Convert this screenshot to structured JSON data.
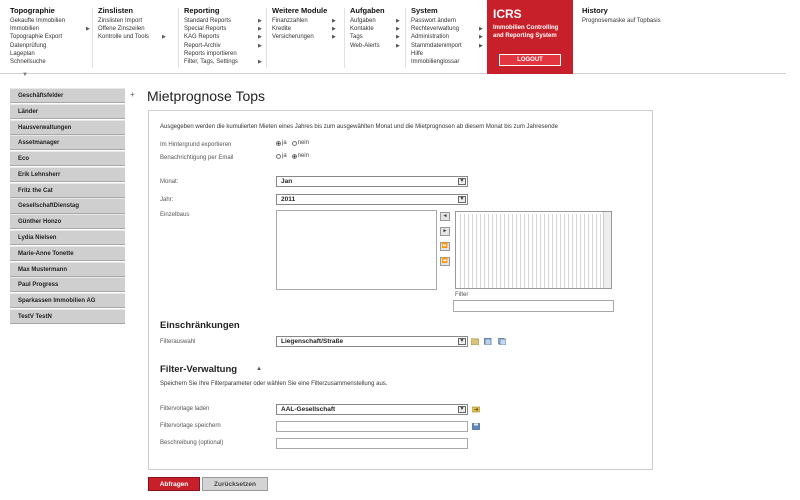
{
  "nav": {
    "columns": [
      {
        "head": "Topographie",
        "items": [
          {
            "label": "Gekaufte Immobilien",
            "sub": false
          },
          {
            "label": "Immobilien",
            "sub": true
          },
          {
            "label": "Topographie Export",
            "sub": false
          },
          {
            "label": "Datenprüfung",
            "sub": false
          },
          {
            "label": "Lageplan",
            "sub": false
          },
          {
            "label": "Schnellsuche",
            "sub": false
          }
        ]
      },
      {
        "head": "Zinslisten",
        "items": [
          {
            "label": "Zinslisten Import",
            "sub": false
          },
          {
            "label": "Offene Zinszeilen",
            "sub": false
          },
          {
            "label": "Kontrolle und Tools",
            "sub": true
          }
        ]
      },
      {
        "head": "Reporting",
        "items": [
          {
            "label": "Standard Reports",
            "sub": true
          },
          {
            "label": "Special Reports",
            "sub": true
          },
          {
            "label": "KAG Reports",
            "sub": true
          },
          {
            "label": "Report-Archiv",
            "sub": true
          },
          {
            "label": "Reports importieren",
            "sub": false
          },
          {
            "label": "Filter, Tags, Settings",
            "sub": true
          }
        ]
      },
      {
        "head": "Weitere Module",
        "items": [
          {
            "label": "Finanzzahlen",
            "sub": true
          },
          {
            "label": "Kredite",
            "sub": true
          },
          {
            "label": "Versicherungen",
            "sub": true
          }
        ]
      },
      {
        "head": "Aufgaben",
        "items": [
          {
            "label": "Aufgaben",
            "sub": true
          },
          {
            "label": "Kontakte",
            "sub": true
          },
          {
            "label": "Tags",
            "sub": true
          },
          {
            "label": "Web-Alerts",
            "sub": true
          }
        ]
      },
      {
        "head": "System",
        "items": [
          {
            "label": "Passwort ändern",
            "sub": false
          },
          {
            "label": "Rechteverwaltung",
            "sub": true
          },
          {
            "label": "Administration",
            "sub": true
          },
          {
            "label": "Stammdatenimport",
            "sub": true
          },
          {
            "label": "Hilfe",
            "sub": false
          },
          {
            "label": "Immobilienglossar",
            "sub": false
          }
        ]
      }
    ],
    "icrs": {
      "title": "ICRS",
      "subtitle": "Immobilien Controlling and Reporting System",
      "logout": "LOGOUT"
    },
    "history": {
      "head": "History",
      "item": "Prognosemaske auf Topbasis"
    },
    "toggle": "▼"
  },
  "sidebar": {
    "plus": "+",
    "items": [
      "Geschäftsfelder",
      "Länder",
      "Hausverwaltungen",
      "Assetmanager",
      "Eco",
      "Erik Lehnsherr",
      "Fritz the Cat",
      "GesellschaftDienstag",
      "Günther Honzo",
      "Lydia Nielsen",
      "Marie-Anne Tonette",
      "Max Mustermann",
      "Paul Progress",
      "Sparkassen Immobilien AG",
      "TestV TestN"
    ]
  },
  "page": {
    "title": "Mietprognose Tops"
  },
  "form": {
    "intro": "Ausgegeben werden die kumulierten Mieten eines Jahres bis zum ausgewählten Monat und die Mietprognosen ab diesem Monat bis zum Jahresende",
    "background_label": "Im Hintergrund exportieren",
    "email_label": "Benachrichtigung per Email",
    "ja": "ja",
    "nein": "nein",
    "month_label": "Monat:",
    "month_value": "Jan",
    "year_label": "Jahr:",
    "year_value": "2011",
    "units_label": "Einzelbaus",
    "filter_label": "Filter",
    "move_buttons": [
      "◄",
      "►",
      "⏩",
      "⏪"
    ]
  },
  "restrictions": {
    "heading": "Einschränkungen",
    "filter_label": "Filterauswahl",
    "filter_value": "Liegenschaft/Straße"
  },
  "filter_admin": {
    "heading": "Filter-Verwaltung",
    "toggle": "▲",
    "description": "Speichern Sie Ihre Filterparameter oder wählen Sie eine Filterzusammenstellung aus.",
    "load_label": "Filtervorlage laden",
    "load_value": "AAL-Gesellschaft",
    "save_label": "Filtervorlage speichern",
    "desc_label": "Beschreibung (optional)"
  },
  "buttons": {
    "apply": "Abfragen",
    "reset": "Zurücksetzen"
  },
  "colors": {
    "brand_red": "#c8202a",
    "sidebar_bg": "#cfcfcf"
  }
}
